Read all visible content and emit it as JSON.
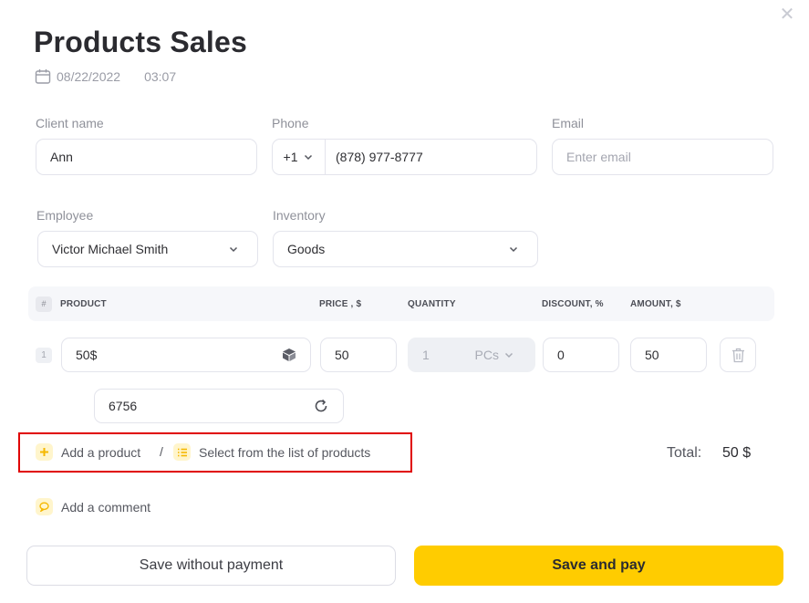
{
  "dialog": {
    "title": "Products Sales",
    "date": "08/22/2022",
    "time": "03:07",
    "close_icon": "close-icon"
  },
  "client": {
    "name_label": "Client name",
    "name_value": "Ann",
    "phone_label": "Phone",
    "phone_code": "+1",
    "phone_value": "(878) 977-8777",
    "email_label": "Email",
    "email_placeholder": "Enter email"
  },
  "assignment": {
    "employee_label": "Employee",
    "employee_value": "Victor Michael Smith",
    "inventory_label": "Inventory",
    "inventory_value": "Goods"
  },
  "table": {
    "headers": {
      "hash": "#",
      "product": "PRODUCT",
      "price": "PRICE , $",
      "quantity": "QUANTITY",
      "discount": "DISCOUNT, %",
      "amount": "AMOUNT, $"
    },
    "rows": [
      {
        "num": "1",
        "product": "50$",
        "price": "50",
        "quantity": "1",
        "unit": "PCs",
        "discount": "0",
        "amount": "50",
        "barcode": "6756"
      }
    ]
  },
  "actions": {
    "add_product": "Add a product",
    "separator": "/",
    "select_from_list": "Select from the list of products",
    "add_comment": "Add a comment"
  },
  "summary": {
    "total_label": "Total:",
    "total_value": "50 $"
  },
  "footer": {
    "save_without_payment": "Save without payment",
    "save_and_pay": "Save and pay"
  },
  "colors": {
    "accent": "#ffcc00",
    "highlight_border": "#e00000"
  }
}
